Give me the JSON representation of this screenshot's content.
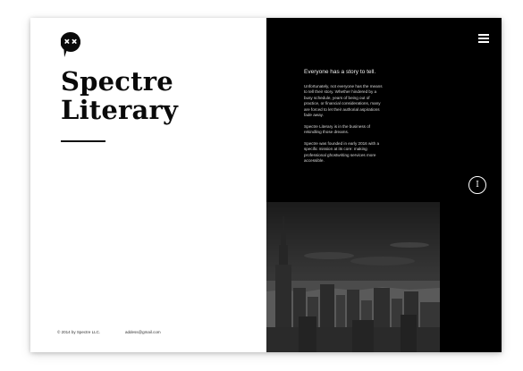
{
  "brand": {
    "logo_icon": "speech-quote-icon",
    "name_line1": "Spectre",
    "name_line2": "Literary"
  },
  "footer": {
    "copyright": "© 2014 by Spectre LLC.",
    "email": "addess@gmail.com"
  },
  "header": {
    "menu_icon": "hamburger-menu-icon"
  },
  "story": {
    "heading": "Everyone has a story to tell.",
    "paragraph1": "Unfortunately, not everyone has the means to tell their story. Whether hindered by a busy schedule, years of being out of practice, or financial considerations, many are forced to let their authorial aspirations fade away.",
    "paragraph2": "Spectre Literary is in the business of rekindling those dreams.",
    "paragraph3": "Spectre was founded in early 2016 with a specific mission at its core: making professional ghostwriting services more accessible."
  },
  "info_button": {
    "label": "I"
  },
  "photo": {
    "subject": "city-skyline-photo"
  },
  "colors": {
    "background_dark": "#000000",
    "background_light": "#ffffff",
    "text_dark": "#0a0a0a",
    "text_light": "#f0f0f0"
  }
}
